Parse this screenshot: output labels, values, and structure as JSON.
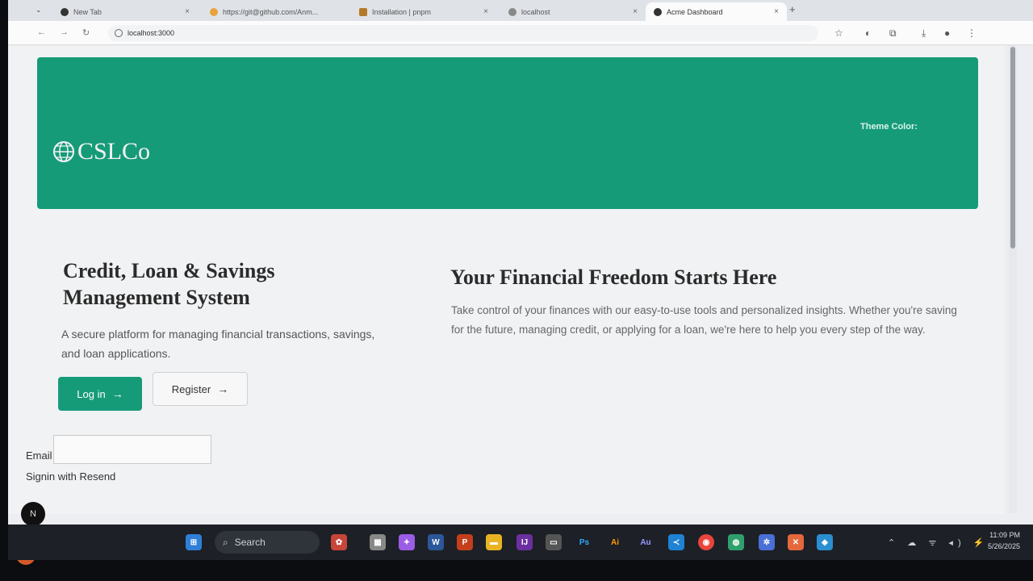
{
  "browser": {
    "tabs": [
      {
        "label": "New Tab"
      },
      {
        "label": "https://git@github.com/Anm..."
      },
      {
        "label": "Installation | pnpm"
      },
      {
        "label": "localhost"
      },
      {
        "label": "Acme Dashboard"
      }
    ],
    "url": "localhost:3000"
  },
  "header": {
    "logo_text": "CSLCo",
    "theme_label": "Theme Color:"
  },
  "hero": {
    "title": "Credit, Loan & Savings Management System",
    "subtitle": "A secure platform for managing financial transactions, savings, and loan applications.",
    "login_label": "Log in",
    "register_label": "Register",
    "arrow": "→"
  },
  "promo": {
    "heading": "Your Financial Freedom Starts Here",
    "paragraph": "Take control of your finances with our easy-to-use tools and personalized insights. Whether you're saving for the future, managing credit, or applying for a loan, we're here to help you every step of the way."
  },
  "signin": {
    "email_label": "Email",
    "link_text": "Signin with Resend"
  },
  "avatar_letter": "N",
  "taskbar": {
    "search_label": "Search",
    "time": "11:09 PM",
    "date": "5/26/2025",
    "apps": [
      {
        "name": "ps",
        "text": "Ps",
        "color": "#31a8ff"
      },
      {
        "name": "ai",
        "text": "Ai",
        "color": "#ff9a00"
      },
      {
        "name": "au",
        "text": "Au",
        "color": "#9999ff"
      }
    ]
  },
  "colors": {
    "brand": "#169b79"
  }
}
